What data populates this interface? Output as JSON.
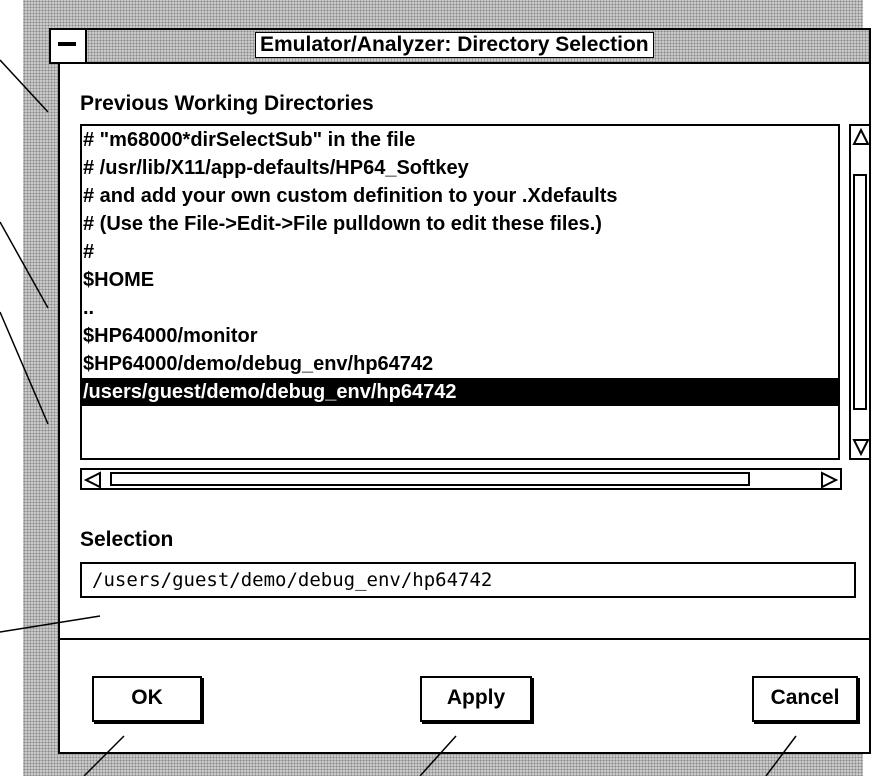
{
  "window": {
    "title": "Emulator/Analyzer: Directory Selection"
  },
  "list": {
    "label": "Previous Working Directories",
    "items": [
      "# \"m68000*dirSelectSub\" in the file",
      "# /usr/lib/X11/app-defaults/HP64_Softkey",
      "# and add your own custom definition to your .Xdefaults",
      "# (Use the File->Edit->File pulldown to edit these files.)",
      "#",
      "$HOME",
      "..",
      "$HP64000/monitor",
      "$HP64000/demo/debug_env/hp64742",
      "/users/guest/demo/debug_env/hp64742"
    ],
    "selected_index": 9
  },
  "selection": {
    "label": "Selection",
    "value": "/users/guest/demo/debug_env/hp64742"
  },
  "buttons": {
    "ok": "OK",
    "apply": "Apply",
    "cancel": "Cancel"
  },
  "icons": {
    "window_menu": "window-menu-icon",
    "scroll_up": "arrow-up-icon",
    "scroll_down": "arrow-down-icon",
    "scroll_left": "arrow-left-icon",
    "scroll_right": "arrow-right-icon"
  },
  "colors": {
    "frame_pattern": "#c8c8c8",
    "selection_bg": "#000000",
    "selection_fg": "#ffffff"
  }
}
